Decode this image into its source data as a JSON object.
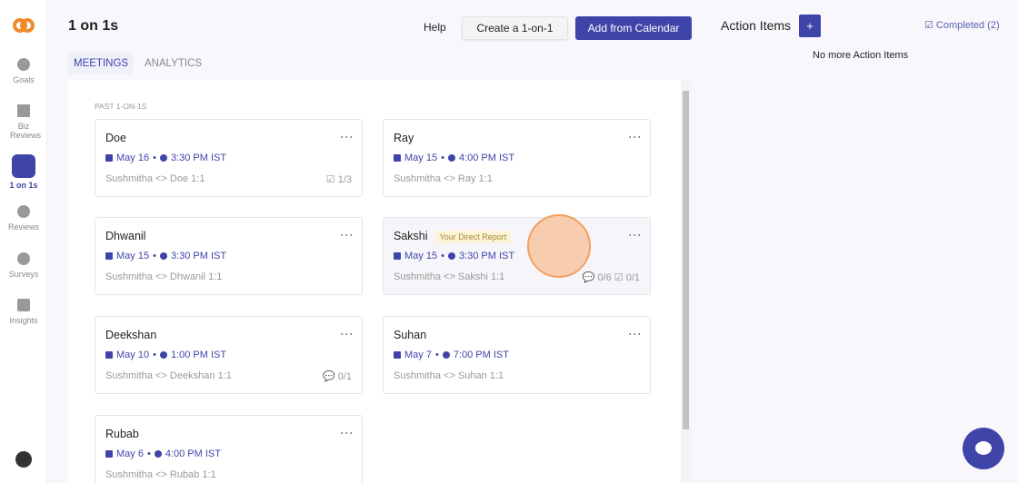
{
  "sidebar": {
    "items": [
      {
        "label": "Goals"
      },
      {
        "label": "Biz Reviews"
      },
      {
        "label": "1 on 1s"
      },
      {
        "label": "Reviews"
      },
      {
        "label": "Surveys"
      },
      {
        "label": "Insights"
      }
    ]
  },
  "header": {
    "title": "1 on 1s",
    "help": "Help",
    "create": "Create a 1-on-1",
    "add_calendar": "Add from Calendar"
  },
  "tabs": [
    {
      "label": "MEETINGS"
    },
    {
      "label": "ANALYTICS"
    }
  ],
  "section_label": "PAST 1-ON-1S",
  "meetings": [
    {
      "name": "Doe",
      "date": "May 16",
      "time": "3:30 PM IST",
      "subtitle": "Sushmitha <> Doe 1:1",
      "meta": "☑ 1/3"
    },
    {
      "name": "Ray",
      "date": "May 15",
      "time": "4:00 PM IST",
      "subtitle": "Sushmitha <> Ray 1:1",
      "meta": ""
    },
    {
      "name": "Dhwanil",
      "date": "May 15",
      "time": "3:30 PM IST",
      "subtitle": "Sushmitha <> Dhwanil 1:1",
      "meta": ""
    },
    {
      "name": "Sakshi",
      "badge": "Your Direct Report",
      "date": "May 15",
      "time": "3:30 PM IST",
      "subtitle": "Sushmitha <> Sakshi 1:1",
      "meta": "💬 0/6  ☑ 0/1"
    },
    {
      "name": "Deekshan",
      "date": "May 10",
      "time": "1:00 PM IST",
      "subtitle": "Sushmitha <> Deekshan 1:1",
      "meta": "💬 0/1"
    },
    {
      "name": "Suhan",
      "date": "May 7",
      "time": "7:00 PM IST",
      "subtitle": "Sushmitha <> Suhan 1:1",
      "meta": ""
    },
    {
      "name": "Rubab",
      "date": "May 6",
      "time": "4:00 PM IST",
      "subtitle": "Sushmitha <> Rubab 1:1",
      "meta": ""
    }
  ],
  "action_items": {
    "title": "Action Items",
    "add": "+",
    "completed": "☑ Completed (2)",
    "empty": "No more Action Items"
  },
  "colors": {
    "accent": "#3f44a8",
    "logo": "#f08a2c"
  }
}
